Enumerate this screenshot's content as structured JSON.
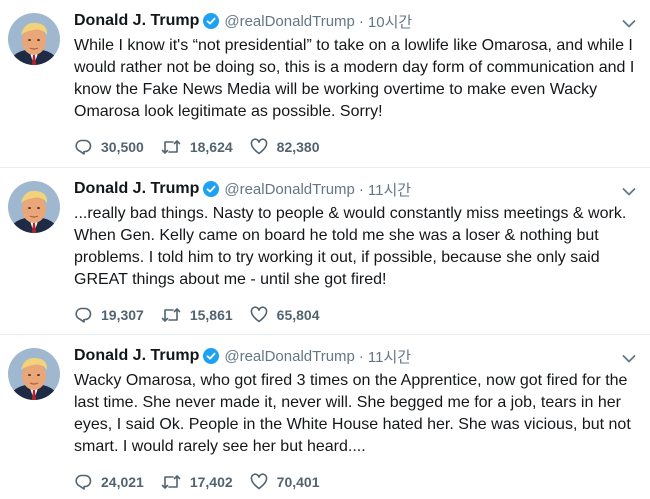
{
  "tweets": [
    {
      "name": "Donald J. Trump",
      "handle": "@realDonaldTrump",
      "separator": "·",
      "time": "10시간",
      "text": "While I know it's “not presidential” to take on a lowlife like Omarosa, and while I would rather not be doing so, this is a modern day form of communication and I know the Fake News Media will be working overtime to make even Wacky Omarosa look legitimate as possible. Sorry!",
      "replies": "30,500",
      "retweets": "18,624",
      "likes": "82,380"
    },
    {
      "name": "Donald J. Trump",
      "handle": "@realDonaldTrump",
      "separator": "·",
      "time": "11시간",
      "text": "...really bad things. Nasty to people & would constantly miss meetings & work. When Gen. Kelly came on board he told me she was a loser & nothing but problems. I told him to try working it out, if possible, because she only said GREAT things about me - until she got fired!",
      "replies": "19,307",
      "retweets": "15,861",
      "likes": "65,804"
    },
    {
      "name": "Donald J. Trump",
      "handle": "@realDonaldTrump",
      "separator": "·",
      "time": "11시간",
      "text": "Wacky Omarosa, who got fired 3 times on the Apprentice, now got fired for the last time. She never made it, never will. She begged me for a job, tears in her eyes, I said Ok. People in the White House hated her. She was vicious, but not smart. I would rarely see her but heard....",
      "replies": "24,021",
      "retweets": "17,402",
      "likes": "70,401"
    }
  ],
  "colors": {
    "verified": "#1da1f2",
    "meta": "#657786",
    "text": "#14171a",
    "divider": "#e6ecf0"
  },
  "icons": {
    "reply": "reply-icon",
    "retweet": "retweet-icon",
    "like": "heart-icon",
    "verified": "verified-badge-icon",
    "menu": "chevron-down-icon"
  }
}
